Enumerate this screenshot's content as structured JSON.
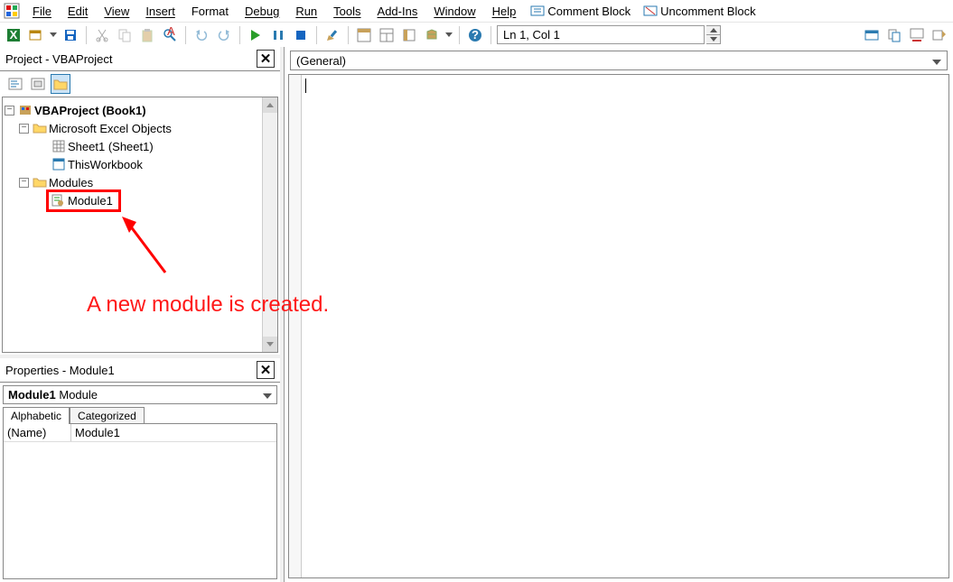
{
  "menu": {
    "file": "File",
    "edit": "Edit",
    "view": "View",
    "insert": "Insert",
    "format": "Format",
    "debug": "Debug",
    "run": "Run",
    "tools": "Tools",
    "addins": "Add-Ins",
    "window": "Window",
    "help": "Help",
    "comment_block": "Comment Block",
    "uncomment_block": "Uncomment Block"
  },
  "toolbar": {
    "status": "Ln 1, Col 1"
  },
  "project_panel": {
    "title": "Project - VBAProject",
    "root": "VBAProject (Book1)",
    "excel_objects": "Microsoft Excel Objects",
    "sheet1": "Sheet1 (Sheet1)",
    "thisworkbook": "ThisWorkbook",
    "modules": "Modules",
    "module1": "Module1"
  },
  "annotation": {
    "text": "A new module is created."
  },
  "properties_panel": {
    "title": "Properties - Module1",
    "combo_name": "Module1",
    "combo_type": "Module",
    "tab_alpha": "Alphabetic",
    "tab_cat": "Categorized",
    "row_key": "(Name)",
    "row_val": "Module1"
  },
  "code": {
    "object_list": "(General)"
  }
}
